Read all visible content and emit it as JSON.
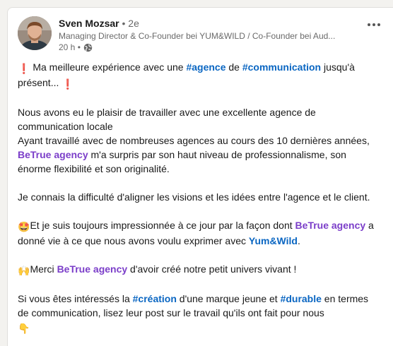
{
  "author": {
    "name": "Sven Mozsar",
    "separator": "•",
    "connection_degree": "2e",
    "headline": "Managing Director & Co-Founder bei YUM&WILD / Co-Founder bei Aud...",
    "time": "20 h •",
    "visibility_icon": "globe-icon",
    "more_icon": "more-horizontal-icon"
  },
  "post": {
    "p1": {
      "emoji_start": "❗",
      "t1": " Ma meilleure expérience avec une ",
      "tag1": "#agence",
      "t2": " de ",
      "tag2": "#communication",
      "t3": " jusqu'à présent... ",
      "emoji_end": "❗"
    },
    "p2": {
      "line1": "Nous avons eu le plaisir de travailler avec une excellente agence de communication locale",
      "t1": "Ayant travaillé avec de nombreuses agences au cours des 10 dernières années, ",
      "mention": "BeTrue agency",
      "t2": " m'a surpris par son haut niveau de professionnalisme, son énorme flexibilité et son originalité."
    },
    "p3": "Je connais la difficulté d'aligner les visions et les idées entre l'agence et le client.",
    "p4": {
      "emoji": "🤩",
      "t1": "Et je suis toujours impressionnée à ce jour par la façon dont ",
      "mention": "BeTrue agency",
      "t2": " a donné vie à ce que nous avons voulu exprimer avec ",
      "mention2": "Yum&Wild",
      "t3": "."
    },
    "p5": {
      "emoji": "🙌",
      "t1": "Merci ",
      "mention": "BeTrue agency",
      "t2": " d'avoir créé notre petit univers vivant !"
    },
    "p6": {
      "t1": "Si vous êtes intéressés la ",
      "tag1": "#création",
      "t2": " d'une marque jeune et ",
      "tag2": "#durable",
      "t3": " en termes de communication, lisez leur post sur le travail qu'ils ont fait pour nous",
      "emoji": "👇"
    }
  },
  "colors": {
    "hashtag": "#0a66c2",
    "mention": "#7b3ec9",
    "text": "#191919",
    "secondary": "#666666"
  }
}
